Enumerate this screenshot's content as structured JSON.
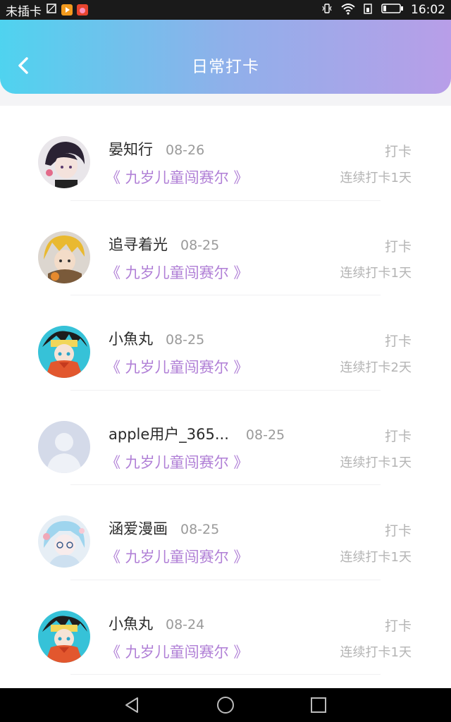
{
  "status_bar": {
    "carrier": "未插卡",
    "time": "16:02",
    "icons": [
      "sim-icon",
      "video-app-icon",
      "huawei-app-icon",
      "vibrate-icon",
      "wifi-icon",
      "data-icon",
      "battery-icon"
    ]
  },
  "header": {
    "title": "日常打卡",
    "back_icon": "chevron-left-icon",
    "gradient": [
      "#4fd3ef",
      "#b89ee8"
    ]
  },
  "records": [
    {
      "name": "晏知行",
      "date": "08-26",
      "book": "《 九岁儿童闯赛尔 》",
      "action": "打卡",
      "streak": "连续打卡1天",
      "avatar": "anime-boy-dark-hair"
    },
    {
      "name": "追寻着光",
      "date": "08-25",
      "book": "《 九岁儿童闯赛尔 》",
      "action": "打卡",
      "streak": "连续打卡1天",
      "avatar": "anime-yellow-hair"
    },
    {
      "name": "小魚丸",
      "date": "08-25",
      "book": "《 九岁儿童闯赛尔 》",
      "action": "打卡",
      "streak": "连续打卡2天",
      "avatar": "anime-blue-hair-orange"
    },
    {
      "name": "apple用户_365...",
      "date": "08-25",
      "book": "《 九岁儿童闯赛尔 》",
      "action": "打卡",
      "streak": "连续打卡1天",
      "avatar": "default-user"
    },
    {
      "name": "涵爱漫画",
      "date": "08-25",
      "book": "《 九岁儿童闯赛尔 》",
      "action": "打卡",
      "streak": "连续打卡1天",
      "avatar": "anime-light-blue-hair"
    },
    {
      "name": "小魚丸",
      "date": "08-24",
      "book": "《 九岁儿童闯赛尔 》",
      "action": "打卡",
      "streak": "连续打卡1天",
      "avatar": "anime-blue-hair-orange"
    }
  ],
  "colors": {
    "book_title": "#b07fd6",
    "muted": "#b4b4b4"
  },
  "nav_bar": {
    "icons": [
      "back-triangle-icon",
      "home-circle-icon",
      "recents-square-icon"
    ]
  }
}
